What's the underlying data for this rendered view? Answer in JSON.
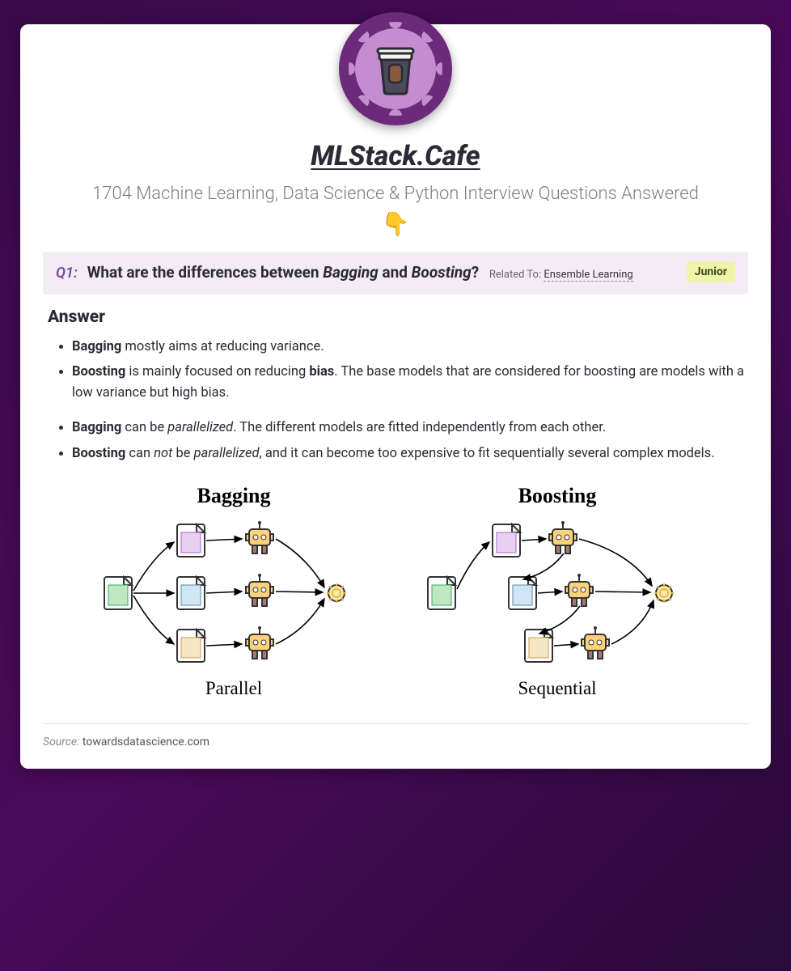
{
  "site": {
    "title": "MLStack.Cafe",
    "tagline": "1704 Machine Learning, Data Science & Python Interview Questions Answered",
    "emoji": "👇"
  },
  "question": {
    "number": "Q1",
    "prefix": "What are the differences between ",
    "term1": "Bagging",
    "mid": " and ",
    "term2": "Boosting",
    "suffix": "?",
    "related_label": "Related To:",
    "related_link": "Ensemble Learning",
    "level_badge": "Junior"
  },
  "answer": {
    "heading": "Answer",
    "group1": [
      {
        "b": "Bagging",
        "rest": " mostly aims at reducing variance."
      },
      {
        "b": "Boosting",
        "rest_pre": " is mainly focused on reducing ",
        "b2": "bias",
        "rest_post": ". The base models that are considered for boosting are models with a low variance but high bias."
      }
    ],
    "group2": [
      {
        "b": "Bagging",
        "rest_pre": " can be ",
        "i": "parallelized",
        "rest_post": ". The different models are fitted independently from each other."
      },
      {
        "b": "Boosting",
        "rest_pre": " can ",
        "i": "not",
        "rest_mid": " be ",
        "i2": "parallelized",
        "rest_post": ", and it can become too expensive to fit sequentially several complex models."
      }
    ]
  },
  "diagram": {
    "left_title": "Bagging",
    "left_sub": "Parallel",
    "right_title": "Boosting",
    "right_sub": "Sequential"
  },
  "source": {
    "label": "Source:",
    "value": "towardsdatascience.com"
  }
}
